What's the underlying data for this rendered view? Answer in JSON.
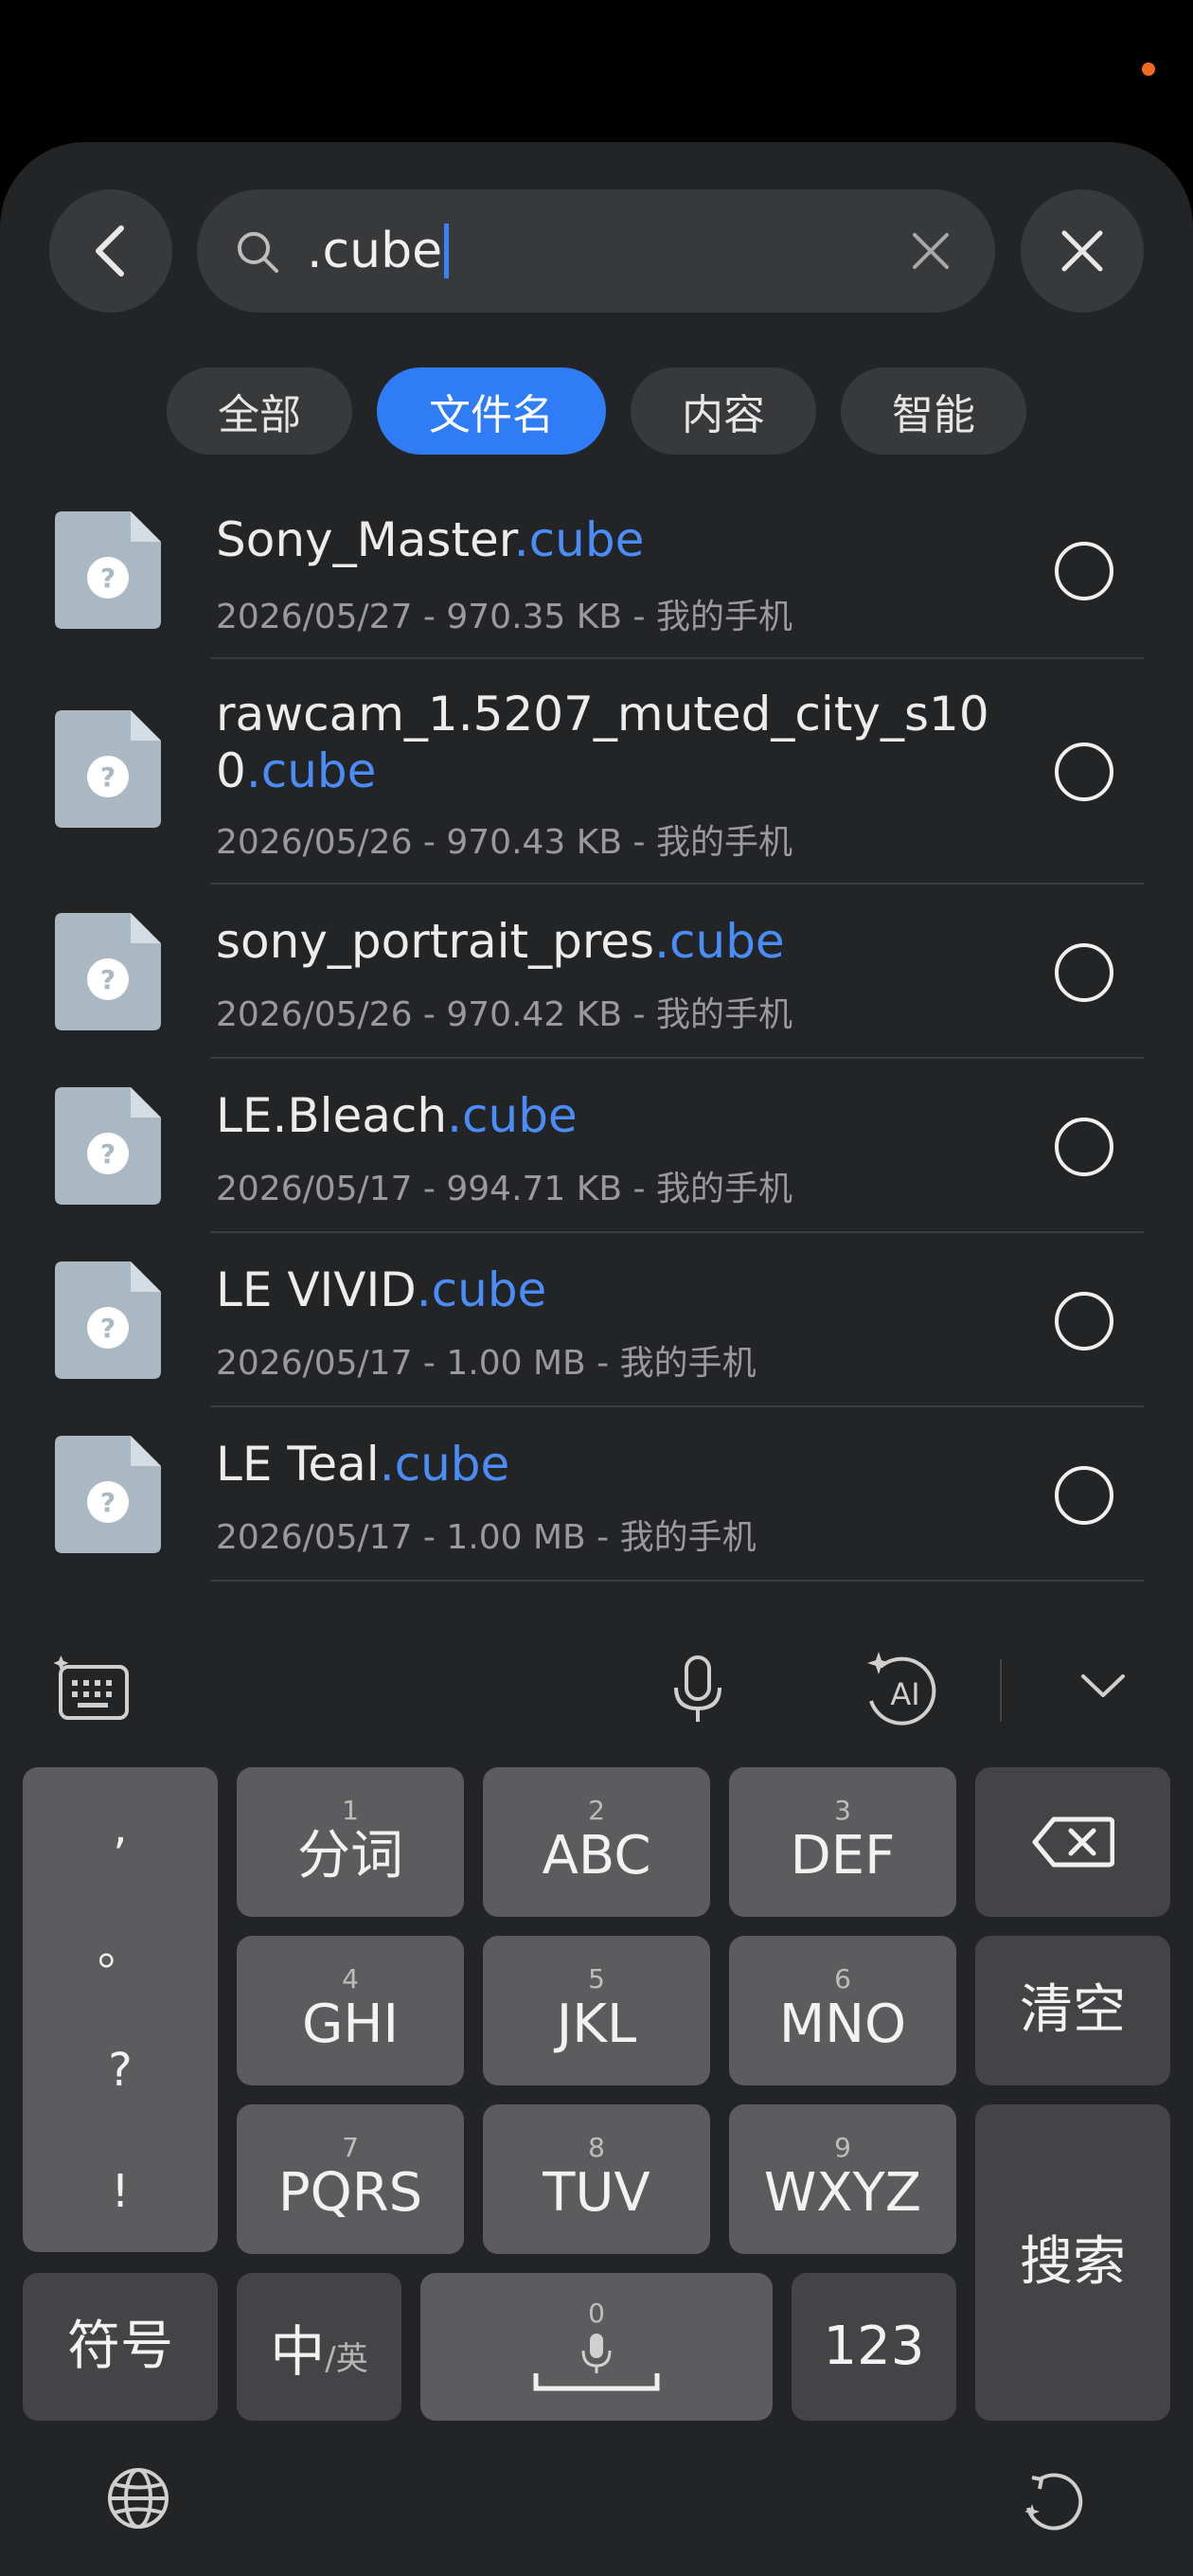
{
  "search": {
    "query": ".cube"
  },
  "filters": [
    {
      "label": "全部",
      "active": false
    },
    {
      "label": "文件名",
      "active": true
    },
    {
      "label": "内容",
      "active": false
    },
    {
      "label": "智能",
      "active": false
    }
  ],
  "files": [
    {
      "base": "Sony_Master",
      "ext": ".cube",
      "meta": "2026/05/27 - 970.35 KB - 我的手机"
    },
    {
      "base": "rawcam_1.5207_muted_city_s100",
      "ext": ".cube",
      "meta": "2026/05/26 - 970.43 KB - 我的手机"
    },
    {
      "base": "sony_portrait_pres",
      "ext": ".cube",
      "meta": "2026/05/26 - 970.42 KB - 我的手机"
    },
    {
      "base": "LE.Bleach",
      "ext": ".cube",
      "meta": "2026/05/17 - 994.71 KB - 我的手机"
    },
    {
      "base": "LE VIVID",
      "ext": ".cube",
      "meta": "2026/05/17 - 1.00 MB - 我的手机"
    },
    {
      "base": "LE Teal",
      "ext": ".cube",
      "meta": "2026/05/17 - 1.00 MB - 我的手机"
    }
  ],
  "keyboard": {
    "punct": [
      ",",
      "。",
      "?",
      "!"
    ],
    "keys": [
      {
        "num": "1",
        "label": "分词"
      },
      {
        "num": "2",
        "label": "ABC"
      },
      {
        "num": "3",
        "label": "DEF"
      },
      {
        "num": "4",
        "label": "GHI"
      },
      {
        "num": "5",
        "label": "JKL"
      },
      {
        "num": "6",
        "label": "MNO"
      },
      {
        "num": "7",
        "label": "PQRS"
      },
      {
        "num": "8",
        "label": "TUV"
      },
      {
        "num": "9",
        "label": "WXYZ"
      }
    ],
    "clear_label": "清空",
    "search_label": "搜索",
    "symbols_label": "符号",
    "zh_label": "中",
    "en_label": "/英",
    "space_num": "0",
    "num_label": "123"
  },
  "colors": {
    "accent": "#2f7cf6",
    "highlight": "#4a8df8",
    "notification": "#f26a22"
  }
}
